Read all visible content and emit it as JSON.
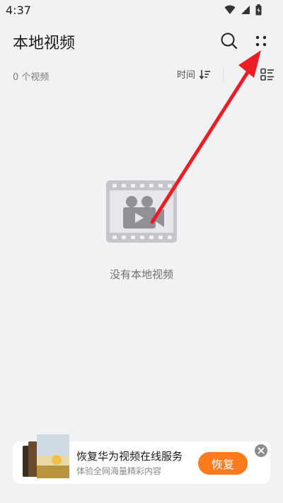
{
  "status_bar": {
    "time": "4:37"
  },
  "header": {
    "title": "本地视频"
  },
  "sub_bar": {
    "count_label": "0 个视频",
    "sort_label": "时间"
  },
  "empty_state": {
    "message": "没有本地视频"
  },
  "banner": {
    "title": "恢复华为视频在线服务",
    "subtitle": "体验全网海量精彩内容",
    "button_label": "恢复"
  },
  "colors": {
    "background": "#f1f2f4",
    "accent": "#ff7a1a",
    "annotation_arrow": "#ee1d24"
  },
  "icons": [
    "wifi-icon",
    "signal-icon",
    "battery-icon",
    "search-icon",
    "more-icon",
    "sort-icon",
    "view-toggle-icon",
    "video-camera-icon",
    "close-icon"
  ]
}
